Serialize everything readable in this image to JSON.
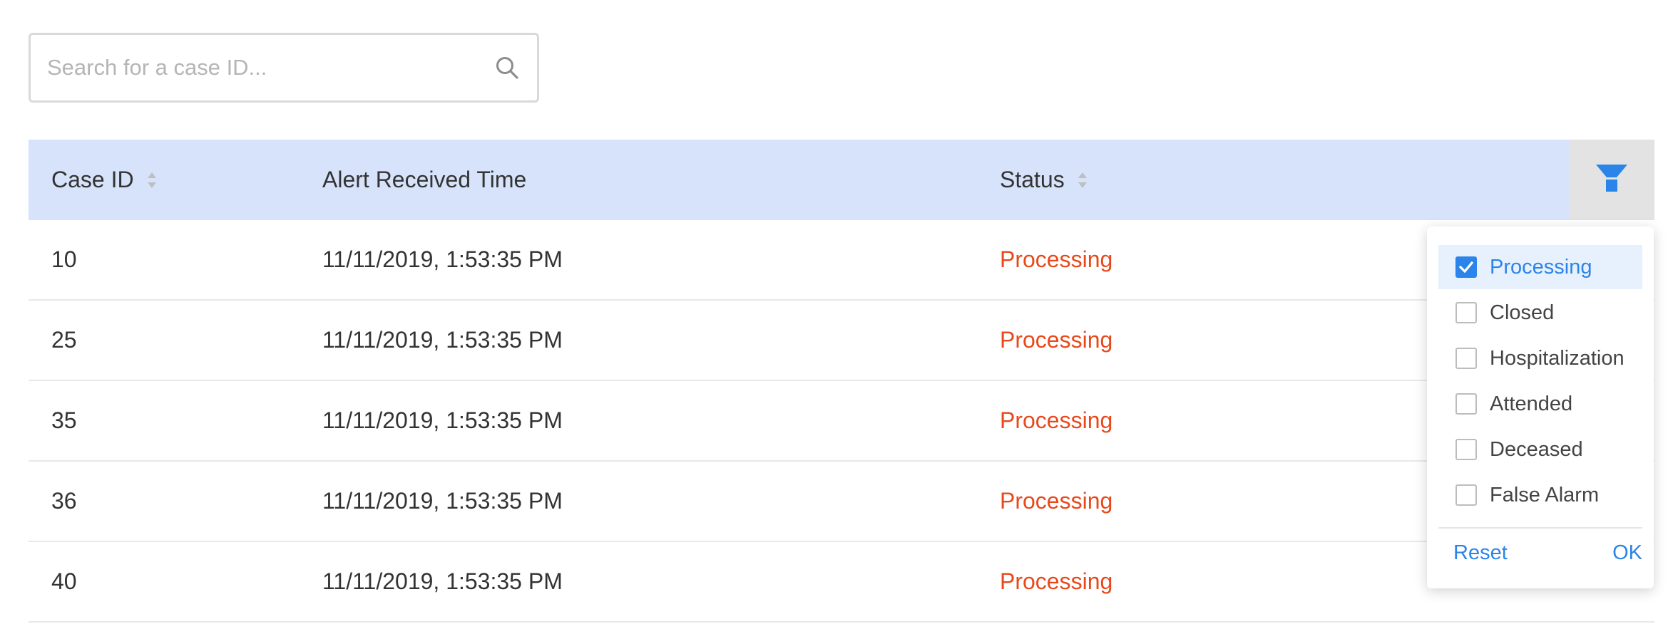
{
  "search": {
    "placeholder": "Search for a case ID...",
    "value": ""
  },
  "table": {
    "columns": [
      {
        "label": "Case ID",
        "sortable": true
      },
      {
        "label": "Alert Received Time",
        "sortable": false
      },
      {
        "label": "Status",
        "sortable": true
      }
    ],
    "rows": [
      {
        "case_id": "10",
        "time": "11/11/2019, 1:53:35 PM",
        "status": "Processing"
      },
      {
        "case_id": "25",
        "time": "11/11/2019, 1:53:35 PM",
        "status": "Processing"
      },
      {
        "case_id": "35",
        "time": "11/11/2019, 1:53:35 PM",
        "status": "Processing"
      },
      {
        "case_id": "36",
        "time": "11/11/2019, 1:53:35 PM",
        "status": "Processing"
      },
      {
        "case_id": "40",
        "time": "11/11/2019, 1:53:35 PM",
        "status": "Processing"
      }
    ]
  },
  "filter": {
    "icon": "filter-funnel-icon",
    "options": [
      {
        "label": "Processing",
        "checked": true
      },
      {
        "label": "Closed",
        "checked": false
      },
      {
        "label": "Hospitalization",
        "checked": false
      },
      {
        "label": "Attended",
        "checked": false
      },
      {
        "label": "Deceased",
        "checked": false
      },
      {
        "label": "False Alarm",
        "checked": false
      }
    ],
    "reset_label": "Reset",
    "ok_label": "OK"
  },
  "colors": {
    "header_bg": "#d7e3fb",
    "status_processing": "#e9491a",
    "accent": "#2b84e9"
  }
}
